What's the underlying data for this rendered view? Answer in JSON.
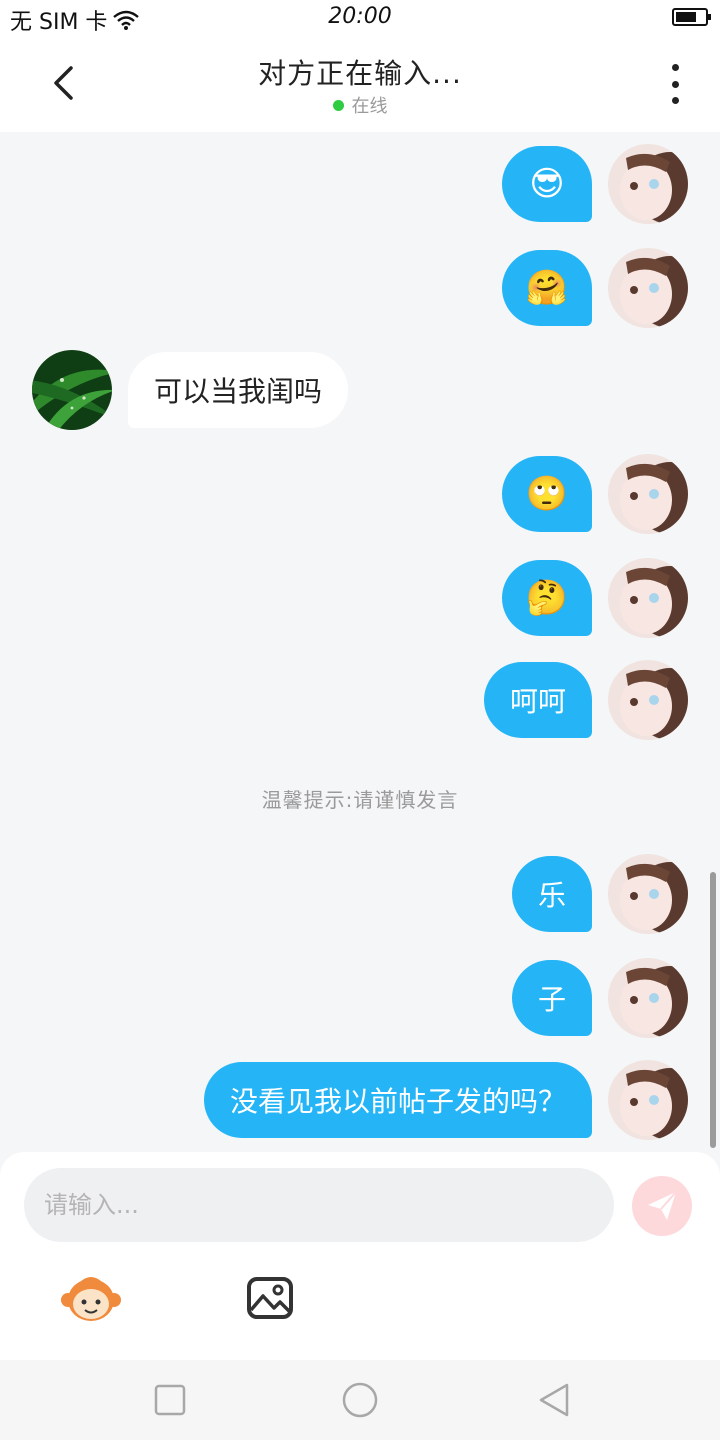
{
  "status_bar": {
    "sim_text": "无 SIM 卡",
    "time": "20:00",
    "battery_level": 0.7,
    "wifi_icon": "wifi-icon",
    "battery_icon": "battery-icon"
  },
  "header": {
    "title": "对方正在输入...",
    "status": "在线",
    "status_color": "#2ecc40",
    "back_icon": "chevron-left-icon",
    "more_icon": "more-vertical-icon"
  },
  "messages": [
    {
      "sender": "me",
      "type": "emoji",
      "content": "😎"
    },
    {
      "sender": "me",
      "type": "emoji",
      "content": "🤗"
    },
    {
      "sender": "them",
      "type": "text",
      "content": "可以当我闺吗"
    },
    {
      "sender": "me",
      "type": "emoji",
      "content": "🙄"
    },
    {
      "sender": "me",
      "type": "emoji",
      "content": "🤔"
    },
    {
      "sender": "me",
      "type": "text",
      "content": "呵呵"
    },
    {
      "sender": "me",
      "type": "text",
      "content": "乐"
    },
    {
      "sender": "me",
      "type": "text",
      "content": "子"
    },
    {
      "sender": "me",
      "type": "text",
      "content": "没看见我以前帖子发的吗？"
    }
  ],
  "tip": "温馨提示:请谨慎发言",
  "composer": {
    "placeholder": "请输入...",
    "send_icon": "send-icon",
    "emoji_tool_icon": "monkey-sticker-icon",
    "image_tool_icon": "image-icon"
  },
  "colors": {
    "my_bubble": "#25b5f7",
    "their_bubble": "#ffffff",
    "background": "#f4f6f8",
    "send_button": "#fdd9dc"
  },
  "nav_bar": {
    "recent_icon": "square-icon",
    "home_icon": "circle-icon",
    "back_icon": "triangle-back-icon"
  }
}
